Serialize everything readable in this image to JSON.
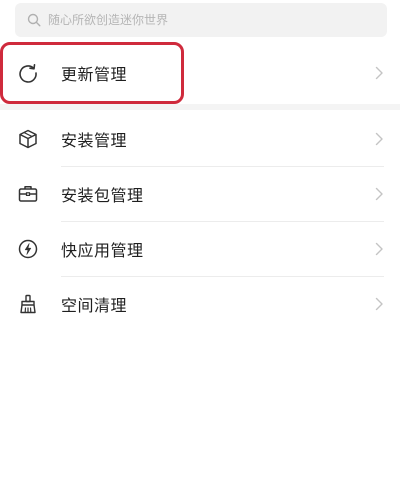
{
  "search": {
    "placeholder": "随心所欲创造迷你世界",
    "value": ""
  },
  "menu": {
    "items": [
      {
        "id": "update",
        "label": "更新管理",
        "icon": "refresh-icon"
      },
      {
        "id": "install",
        "label": "安装管理",
        "icon": "package-box-icon"
      },
      {
        "id": "install-package",
        "label": "安装包管理",
        "icon": "briefcase-icon"
      },
      {
        "id": "quick-app",
        "label": "快应用管理",
        "icon": "lightning-icon"
      },
      {
        "id": "space-clean",
        "label": "空间清理",
        "icon": "broom-icon"
      }
    ]
  },
  "highlight": {
    "color": "#cf2a3c",
    "target": "update"
  },
  "colors": {
    "icon_stroke": "#333333",
    "chevron": "#c4c4c4",
    "search_bg": "#f2f2f2",
    "divider": "#ececec"
  }
}
